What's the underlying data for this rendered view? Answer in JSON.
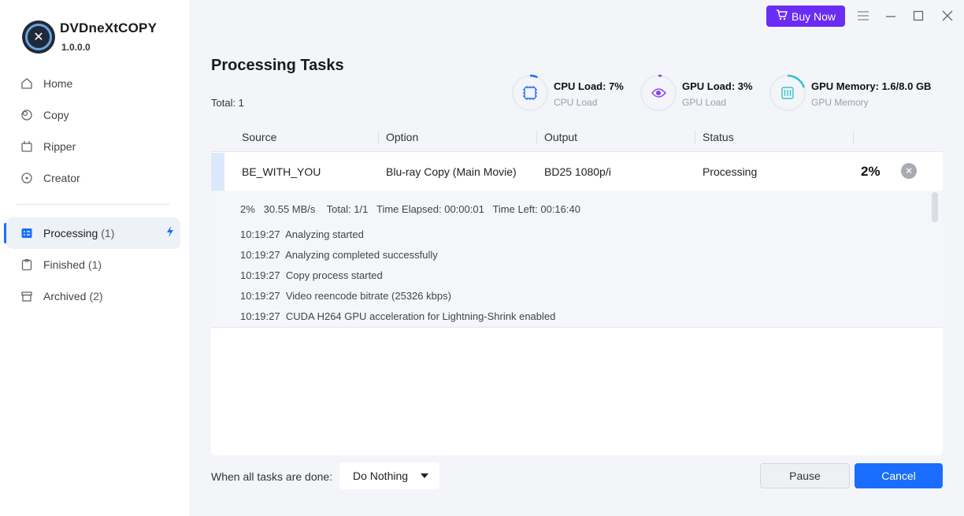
{
  "app": {
    "name": "DVDneXtCOPY",
    "version": "1.0.0.0",
    "buy_label": "Buy Now",
    "accent_color": "#1a6dff",
    "buy_color": "#6b2cf5"
  },
  "sidebar": {
    "items": [
      {
        "label": "Home",
        "icon": "home-icon"
      },
      {
        "label": "Copy",
        "icon": "copy-icon"
      },
      {
        "label": "Ripper",
        "icon": "ripper-icon"
      },
      {
        "label": "Creator",
        "icon": "creator-icon"
      }
    ],
    "tasks": [
      {
        "label": "Processing",
        "count": "(1)",
        "icon": "processing-icon",
        "active": true
      },
      {
        "label": "Finished",
        "count": "(1)",
        "icon": "finished-icon"
      },
      {
        "label": "Archived",
        "count": "(2)",
        "icon": "archived-icon"
      }
    ]
  },
  "header": {
    "title": "Processing Tasks",
    "total": "Total: 1"
  },
  "meters": [
    {
      "title": "CPU Load: 7%",
      "sub": "CPU Load",
      "icon": "cpu-icon",
      "value": 0.07,
      "color": "#1a6dff"
    },
    {
      "title": "GPU Load: 3%",
      "sub": "GPU Load",
      "icon": "gpu-icon",
      "value": 0.03,
      "color": "#8a3ff0"
    },
    {
      "title": "GPU Memory: 1.6/8.0 GB",
      "sub": "GPU Memory",
      "icon": "memory-icon",
      "value": 0.2,
      "color": "#2fc3c9"
    }
  ],
  "table": {
    "columns": [
      "Source",
      "Option",
      "Output",
      "Status"
    ],
    "row": {
      "source": "BE_WITH_YOU",
      "option": "Blu-ray Copy (Main Movie)",
      "output": "BD25 1080p/i",
      "status": "Processing",
      "percent": "2%"
    },
    "progress": {
      "percent": "2%",
      "speed": "30.55 MB/s",
      "total": "Total: 1/1",
      "elapsed": "Time Elapsed: 00:00:01",
      "left": "Time Left: 00:16:40"
    },
    "log": [
      {
        "time": "10:19:27",
        "text": "Analyzing started"
      },
      {
        "time": "10:19:27",
        "text": "Analyzing completed successfully"
      },
      {
        "time": "10:19:27",
        "text": "Copy process started"
      },
      {
        "time": "10:19:27",
        "text": "Video reencode bitrate (25326 kbps)"
      },
      {
        "time": "10:19:27",
        "text": "CUDA H264 GPU acceleration for Lightning-Shrink enabled"
      }
    ]
  },
  "footer": {
    "label": "When all tasks are done:",
    "select_value": "Do Nothing",
    "pause_label": "Pause",
    "cancel_label": "Cancel"
  }
}
